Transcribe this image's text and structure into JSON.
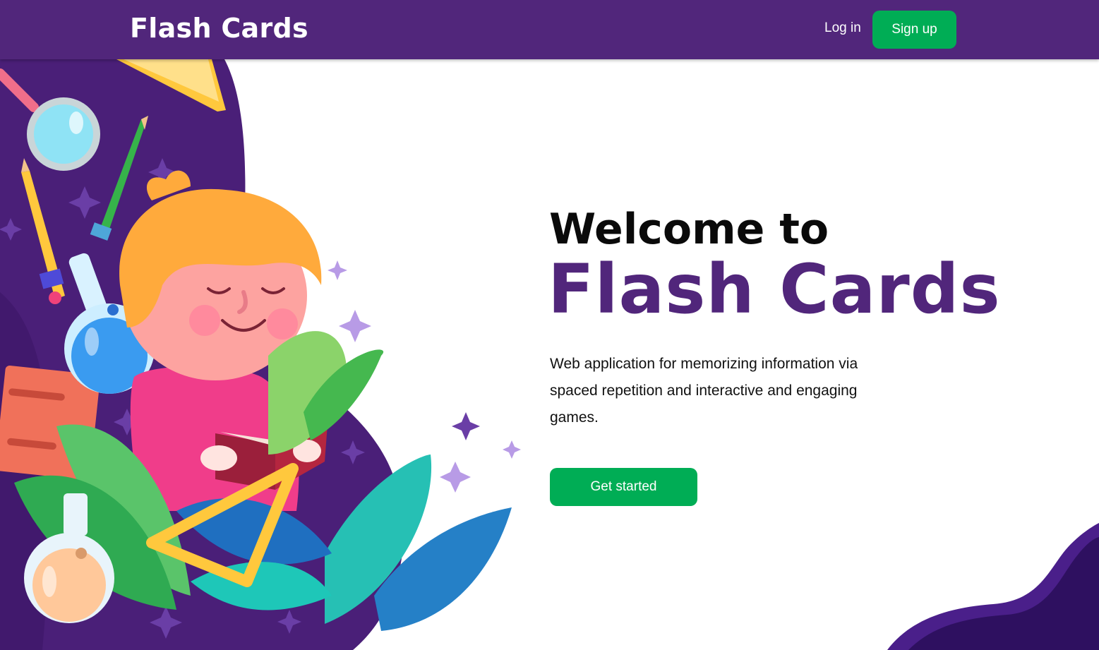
{
  "navbar": {
    "brand": "Flash Cards",
    "login_label": "Log in",
    "signup_label": "Sign up"
  },
  "hero": {
    "welcome": "Welcome to",
    "title": "Flash Cards",
    "description": "Web application for memorizing information via spaced repetition and interactive and engaging games.",
    "cta_label": "Get started"
  },
  "colors": {
    "brand_purple": "#51267b",
    "accent_green": "#00ad55",
    "background": "#ffffff"
  },
  "illustration": {
    "name": "child-reading-book-illustration",
    "icons": [
      "magnifier-icon",
      "pencil-icon",
      "ruler-icon",
      "flask-icon",
      "book-icon",
      "leaf-icon",
      "sparkle-icon"
    ]
  }
}
